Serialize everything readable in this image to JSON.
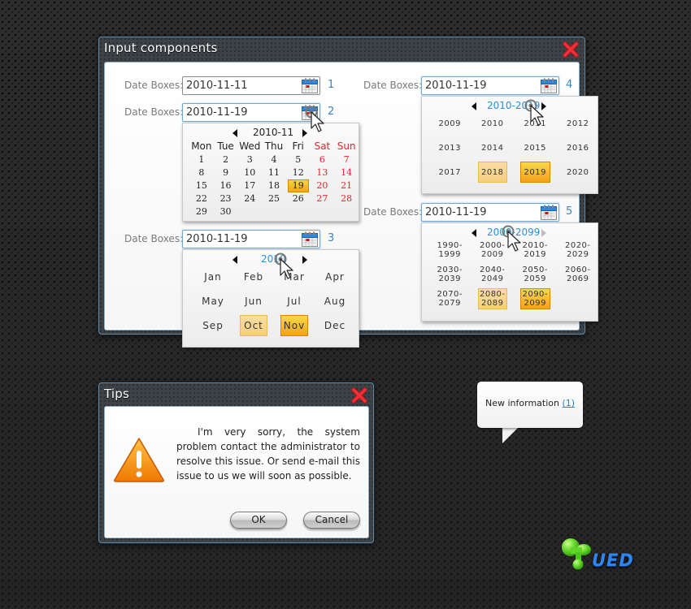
{
  "input_window": {
    "title": "Input components",
    "close_icon": "close-x-icon",
    "rows": [
      {
        "label": "Date Boxes:",
        "value": "2010-11-11",
        "number": "1"
      },
      {
        "label": "Date Boxes:",
        "value": "2010-11-19",
        "number": "2"
      },
      {
        "label": "Date Boxes:",
        "value": "2010-11-19",
        "number": "3"
      },
      {
        "label": "Date Boxes:",
        "value": "2010-11-19",
        "number": "4"
      },
      {
        "label": "Date Boxes:",
        "value": "2010-11-19",
        "number": "5"
      }
    ],
    "day_picker": {
      "title": "2010-11",
      "weekdays": [
        "Mon",
        "Tue",
        "Wed",
        "Thu",
        "Fri",
        "Sat",
        "Sun"
      ],
      "weekend_color": "#e3242b",
      "weeks": [
        [
          "1",
          "2",
          "3",
          "4",
          "5",
          "6",
          "7"
        ],
        [
          "8",
          "9",
          "10",
          "11",
          "12",
          "13",
          "14"
        ],
        [
          "15",
          "16",
          "17",
          "18",
          "19",
          "20",
          "21"
        ],
        [
          "22",
          "23",
          "24",
          "25",
          "26",
          "27",
          "28"
        ],
        [
          "29",
          "30",
          "",
          "",
          "",
          "",
          ""
        ]
      ],
      "selected": "19"
    },
    "month_picker": {
      "title": "2010",
      "months": [
        "Jan",
        "Feb",
        "Mar",
        "Apr",
        "May",
        "Jun",
        "Jul",
        "Aug",
        "Sep",
        "Oct",
        "Nov",
        "Dec"
      ],
      "highlighted": "Oct",
      "selected": "Nov"
    },
    "year_picker": {
      "title": "2010-2019",
      "years": [
        "2009",
        "2010",
        "2011",
        "2012",
        "2013",
        "2014",
        "2015",
        "2016",
        "2017",
        "2018",
        "2019",
        "2020"
      ],
      "highlighted": "2018",
      "selected": "2019"
    },
    "decade_picker": {
      "title": "2000-2099",
      "decades": [
        "1990-\n1999",
        "2000-\n2009",
        "2010-\n2019",
        "2020-\n2029",
        "2030-\n2039",
        "2040-\n2049",
        "2050-\n2059",
        "2060-\n2069",
        "2070-\n2079",
        "2080-\n2089",
        "2090-\n2099"
      ],
      "highlighted": "2080-\n2089",
      "selected": "2090-\n2099",
      "next_disabled": true
    }
  },
  "tips_dialog": {
    "title": "Tips",
    "icon": "warning-icon",
    "message": "I'm very sorry, the system problem contact the administrator to resolve this issue. Or send e-mail this issue to us we will soon as possible.",
    "ok_label": "OK",
    "cancel_label": "Cancel"
  },
  "notification_bubble": {
    "text": "New information",
    "link": "(1)"
  },
  "logo": {
    "text": "UED"
  },
  "colors": {
    "accent_blue": "#2b8fd8",
    "selected_orange": "#f4a11b",
    "highlight_tan": "#f5cf7f",
    "close_red": "#e8232a"
  }
}
